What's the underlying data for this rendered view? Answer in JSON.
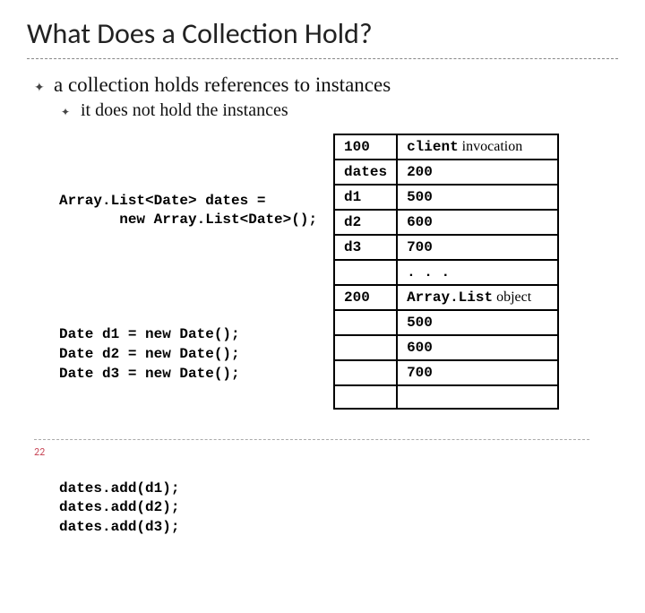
{
  "title": "What Does a Collection Hold?",
  "bullet_main": "a collection holds references to instances",
  "bullet_sub": "it does not hold the instances",
  "code": {
    "b1l1": "Array.List<Date> dates =",
    "b1l2": "       new Array.List<Date>();",
    "b2l1": "Date d1 = new Date();",
    "b2l2": "Date d2 = new Date();",
    "b2l3": "Date d3 = new Date();",
    "b3l1": "dates.add(d1);",
    "b3l2": "dates.add(d2);",
    "b3l3": "dates.add(d3);"
  },
  "mem": {
    "rows": [
      {
        "k": "100",
        "v": "client",
        "note": " invocation"
      },
      {
        "k": "dates",
        "v": "200",
        "note": ""
      },
      {
        "k": "d1",
        "v": "500",
        "note": ""
      },
      {
        "k": "d2",
        "v": "600",
        "note": ""
      },
      {
        "k": "d3",
        "v": "700",
        "note": ""
      },
      {
        "k": "",
        "v": ". . .",
        "note": ""
      },
      {
        "k": "200",
        "v": "Array.List",
        "note": " object"
      },
      {
        "k": "",
        "v": "500",
        "note": ""
      },
      {
        "k": "",
        "v": "600",
        "note": ""
      },
      {
        "k": "",
        "v": "700",
        "note": ""
      },
      {
        "k": "",
        "v": "",
        "note": ""
      }
    ]
  },
  "page_number": "22",
  "bullet_glyph": "✦",
  "sub_bullet_glyph": "✦"
}
